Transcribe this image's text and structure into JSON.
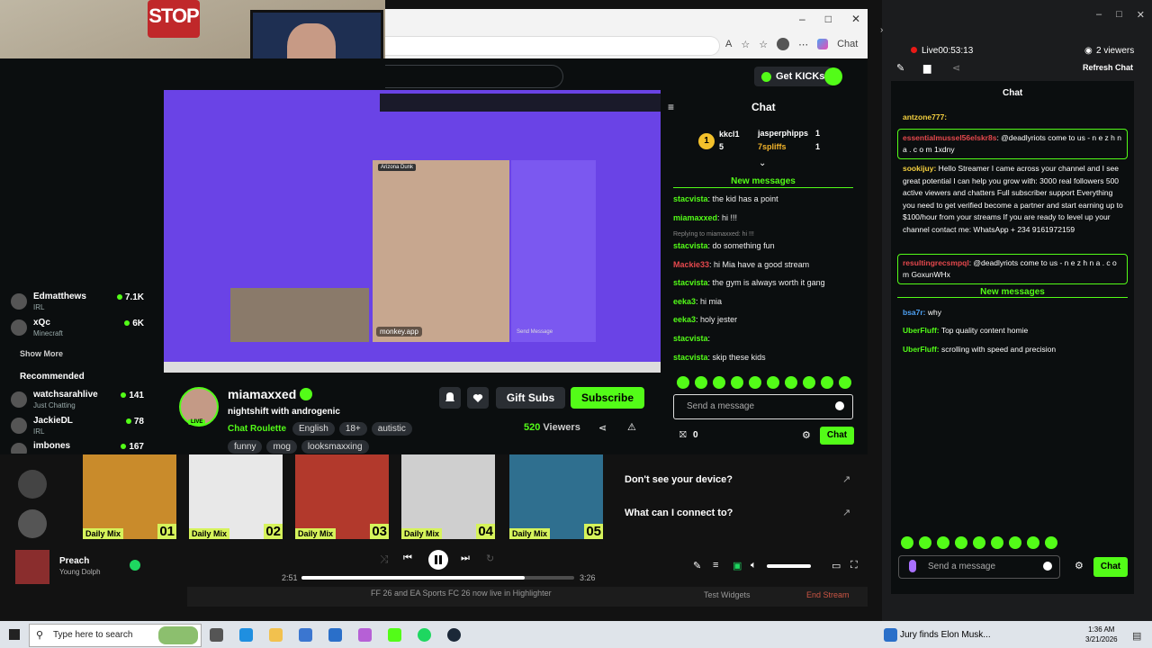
{
  "webcam": {
    "sign_text": "STOP"
  },
  "browser": {
    "controls": [
      "–",
      "□",
      "✕"
    ],
    "chat_label": "Chat"
  },
  "kick": {
    "get_kicks": "Get KICKs",
    "sidebar": {
      "items": [
        {
          "name": "Edmatthews",
          "sub": "IRL",
          "count": "7.1K"
        },
        {
          "name": "xQc",
          "sub": "Minecraft",
          "count": "6K"
        }
      ],
      "show_more": "Show More",
      "recommended": "Recommended",
      "rec_items": [
        {
          "name": "watchsarahlive",
          "sub": "Just Chatting",
          "count": "141"
        },
        {
          "name": "JackieDL",
          "sub": "IRL",
          "count": "78"
        },
        {
          "name": "imbones",
          "sub": "",
          "count": "167"
        }
      ]
    },
    "video": {
      "app_label": "monkey.app",
      "panel_label": "Send Message",
      "cam_label": "Arizona Dunk"
    },
    "streamer": {
      "name": "miamaxxed",
      "live": "LIVE",
      "title": "nightshift with androgenic",
      "category": "Chat Roulette",
      "tags": [
        "English",
        "18+",
        "autistic"
      ],
      "tags2": [
        "funny",
        "mog",
        "looksmaxxing"
      ],
      "viewers_count": "520",
      "viewers_label": "Viewers"
    },
    "buttons": {
      "gift": "Gift Subs",
      "subscribe": "Subscribe"
    },
    "chat": {
      "header": "Chat",
      "leaders": [
        {
          "rank": "1",
          "name": "kkcl1",
          "count": "5"
        },
        {
          "name": "jasperphipps",
          "count": "1"
        },
        {
          "name": "7spliffs",
          "count": "1"
        }
      ],
      "new_messages": "New messages",
      "messages": [
        {
          "user": "stacvista",
          "text": "the kid has a point",
          "color": "#53fc18"
        },
        {
          "user": "miamaxxed",
          "text": "hi !!!",
          "color": "#53fc18"
        },
        {
          "user": "",
          "text": "Replying to miamaxxed: hi !!!",
          "color": "#888"
        },
        {
          "user": "stacvista",
          "text": "do something fun",
          "color": "#53fc18"
        },
        {
          "user": "Mackie33",
          "text": "hi Mia have a good stream",
          "color": "#e5484d"
        },
        {
          "user": "stacvista",
          "text": "the gym is always worth it gang",
          "color": "#53fc18"
        },
        {
          "user": "eeka3",
          "text": "hi mia",
          "color": "#53fc18"
        },
        {
          "user": "eeka3",
          "text": "holy jester",
          "color": "#53fc18"
        },
        {
          "user": "stacvista",
          "text": "",
          "color": "#53fc18"
        },
        {
          "user": "stacvista",
          "text": "skip these kids",
          "color": "#53fc18"
        }
      ],
      "placeholder": "Send a message",
      "kicks_count": "0",
      "send": "Chat"
    }
  },
  "spotify": {
    "mixes": [
      {
        "label": "Daily Mix",
        "num": "01",
        "color": "#c98b2b"
      },
      {
        "label": "Daily Mix",
        "num": "02",
        "color": "#e8e8e8"
      },
      {
        "label": "Daily Mix",
        "num": "03",
        "color": "#b2392c"
      },
      {
        "label": "Daily Mix",
        "num": "04",
        "color": "#cfcfcf"
      },
      {
        "label": "Daily Mix",
        "num": "05",
        "color": "#2f6f8f"
      }
    ],
    "device_q1": "Don't see your device?",
    "device_q2": "What can I connect to?",
    "song": "Preach",
    "artist": "Young Dolph",
    "time_now": "2:51",
    "time_end": "3:26",
    "progress": 0.82,
    "volume": 0.85
  },
  "obs": {
    "ticker": "FF 26 and EA Sports FC 26 now live in Highlighter",
    "test_widgets": "Test Widgets",
    "end_stream": "End Stream"
  },
  "right_panel": {
    "live_time": "Live00:53:13",
    "viewers": "2 viewers",
    "refresh": "Refresh Chat",
    "header": "Chat",
    "msgs": [
      {
        "user": "antzone777:",
        "text": "",
        "cls": "ylw"
      },
      {
        "user": "essentialmussel56elskr8s",
        "text": ": @deadlyriots come to us - n e z h n a . c o m 1xdny",
        "cls": "red",
        "boxed": true
      },
      {
        "user": "sookijuy:",
        "text": " Hello Streamer I came across your channel and I see great potential I can help you grow with: 3000 real followers 500 active viewers and chatters Full subscriber support Everything you need to get verified become a partner and start earning up to $100/hour from your streams If you are ready to level up your channel contact me: WhatsApp + 234 9161972159",
        "cls": "ylw"
      },
      {
        "user": "resultingrecsmpql",
        "text": ": @deadlyriots come to us - n e z h n a . c o m GoxunWHx",
        "cls": "red",
        "boxed": true
      },
      {
        "user": "bsa7r:",
        "text": " why",
        "cls": "blu"
      },
      {
        "user": "UberFluff:",
        "text": " Top quality content homie",
        "cls": "grn"
      },
      {
        "user": "UberFluff:",
        "text": " scrolling with speed and precision",
        "cls": "grn"
      }
    ],
    "new_messages": "New messages",
    "placeholder": "Send a message",
    "send": "Chat"
  },
  "taskbar": {
    "search": "Type here to search",
    "news": "Jury finds Elon Musk...",
    "time": "1:36 AM",
    "date": "3/21/2026"
  }
}
